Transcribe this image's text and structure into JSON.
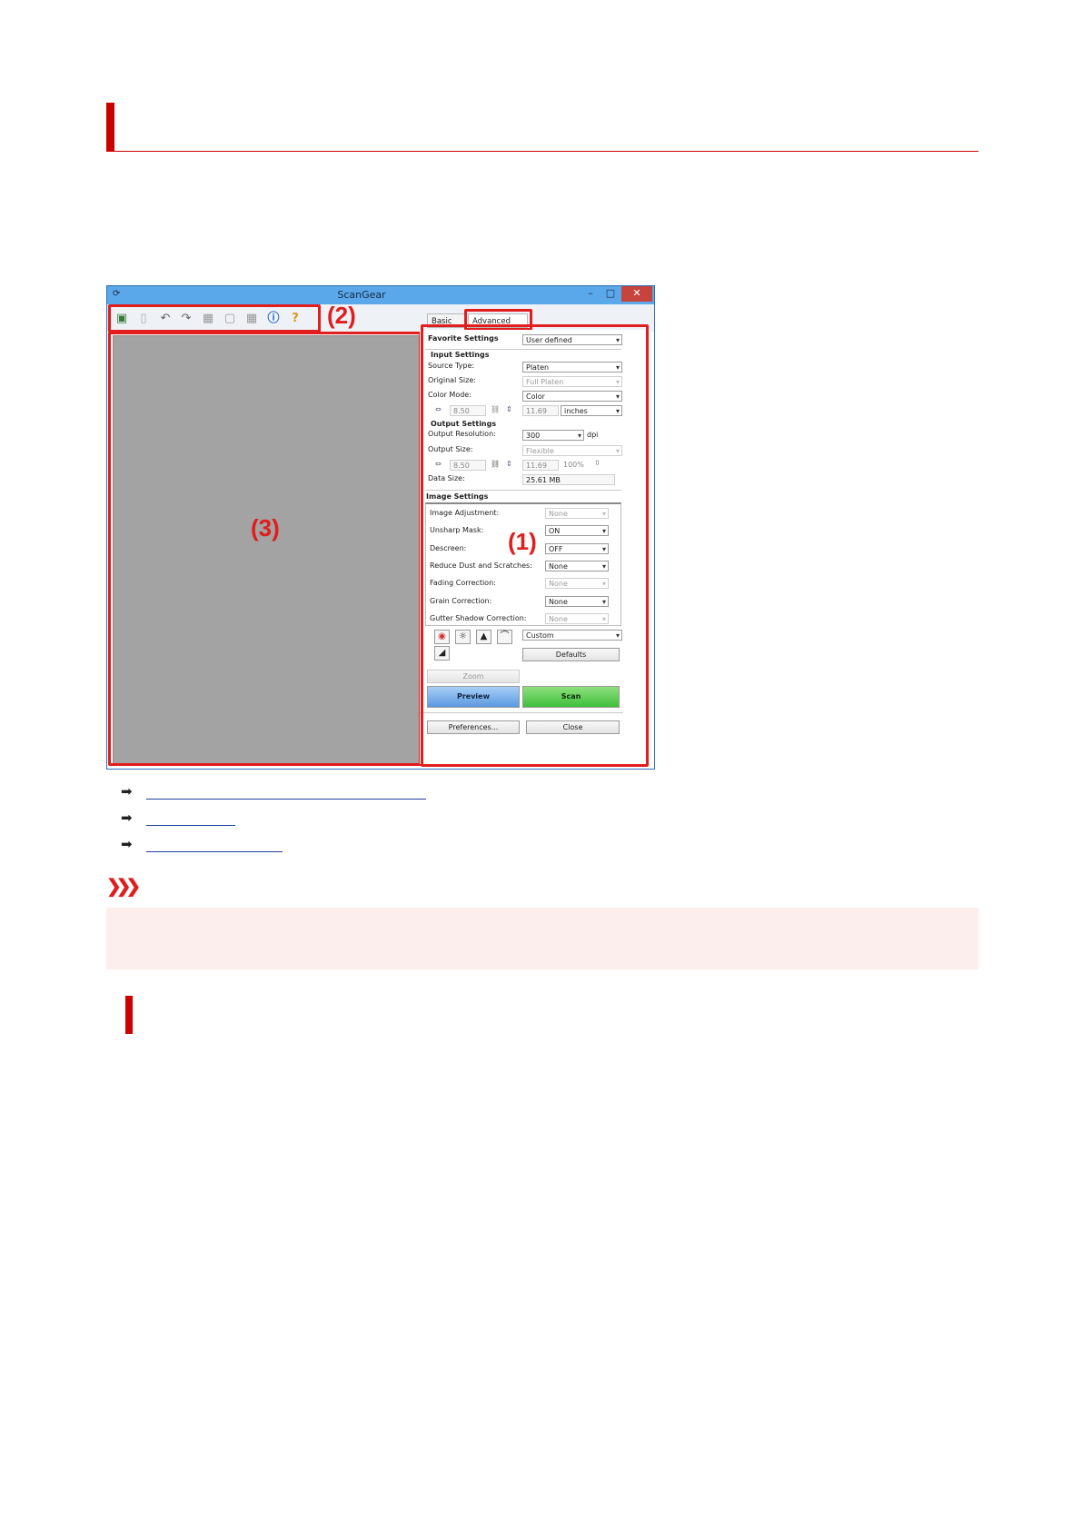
{
  "window": {
    "title": "ScanGear",
    "min_label": "–",
    "max_label": "□",
    "close_label": "✕"
  },
  "toolbar_icons": [
    "scan-photo-icon",
    "blank-page-icon",
    "rotate-left-icon",
    "rotate-right-icon",
    "auto-crop-icon",
    "remove-crop-icon",
    "multi-crop-icon",
    "information-icon",
    "help-icon"
  ],
  "callouts": {
    "one": "(1)",
    "two": "(2)",
    "three": "(3)"
  },
  "tabs": {
    "basic": "Basic Mode",
    "advanced": "Advanced Mode"
  },
  "favorite": {
    "label": "Favorite Settings",
    "value": "User defined"
  },
  "input": {
    "heading": "Input Settings",
    "source_label": "Source Type:",
    "source_value": "Platen",
    "original_label": "Original Size:",
    "original_value": "Full Platen",
    "color_label": "Color Mode:",
    "color_value": "Color",
    "width": "8.50",
    "height": "11.69",
    "unit": "inches"
  },
  "output": {
    "heading": "Output Settings",
    "resolution_label": "Output Resolution:",
    "resolution_value": "300",
    "dpi": "dpi",
    "size_label": "Output Size:",
    "size_value": "Flexible",
    "width": "8.50",
    "height": "11.69",
    "scale": "100%",
    "data_label": "Data Size:",
    "data_value": "25.61 MB"
  },
  "image_settings": {
    "heading": "Image Settings",
    "rows": [
      {
        "label": "Image Adjustment:",
        "value": "None"
      },
      {
        "label": "Unsharp Mask:",
        "value": "ON"
      },
      {
        "label": "Descreen:",
        "value": "OFF"
      },
      {
        "label": "Reduce Dust and Scratches:",
        "value": "None"
      },
      {
        "label": "Fading Correction:",
        "value": "None"
      },
      {
        "label": "Grain Correction:",
        "value": "None"
      },
      {
        "label": "Gutter Shadow Correction:",
        "value": "None"
      }
    ]
  },
  "adjust": {
    "preset": "Custom",
    "defaults": "Defaults"
  },
  "buttons": {
    "zoom": "Zoom",
    "preview": "Preview",
    "scan": "Scan",
    "preferences": "Preferences...",
    "close": "Close"
  },
  "colors": {
    "accent_red": "#cc0000",
    "callout_red": "#e11d1d",
    "link_blue": "#1f3f9f",
    "note_bg": "#fdeeee",
    "scan_green": "#3fbf3a",
    "preview_blue": "#6aa6e8"
  }
}
